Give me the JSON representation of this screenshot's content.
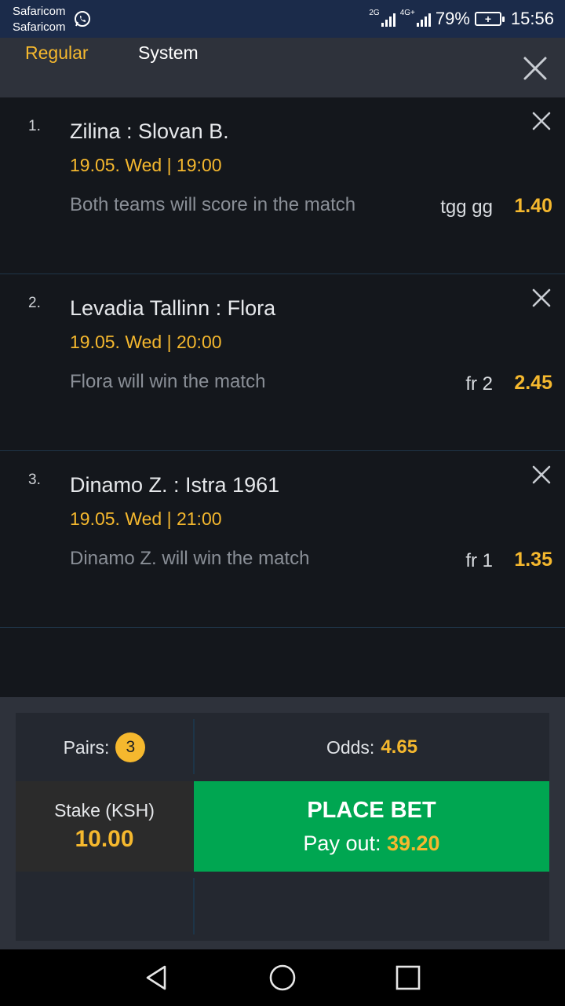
{
  "status_bar": {
    "carrier_line1": "Safaricom",
    "carrier_line2": "Safaricom",
    "net1": "2G",
    "net2": "4G+",
    "battery_percent": "79%",
    "time": "15:56"
  },
  "tabs": {
    "regular": "Regular",
    "system": "System",
    "active": "Regular"
  },
  "bets": [
    {
      "num": "1.",
      "match": "Zilina : Slovan B.",
      "date": "19.05. Wed | 19:00",
      "market": "Both teams will score in the match",
      "code": "tgg gg",
      "odds": "1.40"
    },
    {
      "num": "2.",
      "match": "Levadia Tallinn : Flora",
      "date": "19.05. Wed | 20:00",
      "market": "Flora will win the match",
      "code": "fr 2",
      "odds": "2.45"
    },
    {
      "num": "3.",
      "match": "Dinamo Z. : Istra 1961",
      "date": "19.05. Wed | 21:00",
      "market": "Dinamo Z. will win the match",
      "code": "fr 1",
      "odds": "1.35"
    }
  ],
  "summary": {
    "pairs_label": "Pairs:",
    "pairs_count": "3",
    "odds_label": "Odds:",
    "odds_value": "4.65",
    "stake_label": "Stake (KSH)",
    "stake_value": "10.00",
    "place_bet_label": "PLACE BET",
    "payout_label": "Pay out:",
    "payout_value": "39.20"
  },
  "colors": {
    "accent": "#f5b82e",
    "place_bet_green": "#00a651",
    "background": "#14171c"
  },
  "icons": [
    "whatsapp-icon",
    "signal-icon",
    "battery-icon",
    "close-icon",
    "back-icon",
    "home-icon",
    "recents-icon"
  ]
}
